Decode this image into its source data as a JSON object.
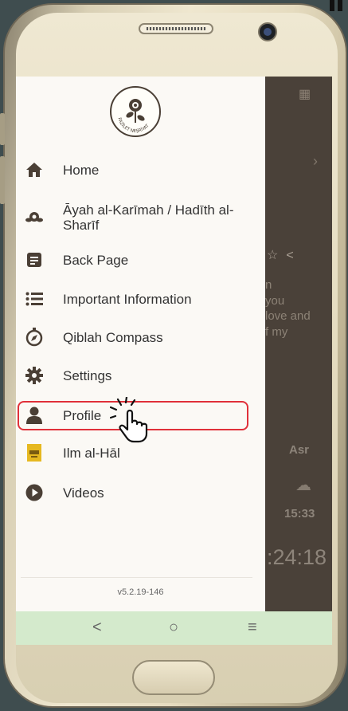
{
  "logo": {
    "text": "FAZİLET NEŞRİYAT"
  },
  "menu": [
    {
      "label": "Home",
      "icon": "home-icon"
    },
    {
      "label": "Āyah al-Karīmah / Hadīth al-Sharīf",
      "icon": "rose-icon"
    },
    {
      "label": "Back Page",
      "icon": "document-icon"
    },
    {
      "label": "Important Information",
      "icon": "list-icon"
    },
    {
      "label": "Qiblah Compass",
      "icon": "compass-icon"
    },
    {
      "label": "Settings",
      "icon": "gear-icon"
    },
    {
      "label": "Profile",
      "icon": "person-icon"
    },
    {
      "label": "Ilm al-Hāl",
      "icon": "book-icon"
    },
    {
      "label": "Videos",
      "icon": "play-icon"
    }
  ],
  "version": "v5.2.19-146",
  "background_app": {
    "text_lines": [
      "n",
      "you",
      "love and",
      "f my"
    ],
    "prayer_name": "Asr",
    "prayer_time": "15:33",
    "countdown": ":24:18"
  },
  "navbar": {
    "back": "<",
    "home": "○",
    "recents": "≡"
  },
  "colors": {
    "highlight": "#e0303a",
    "drawer_bg": "#fbf9f5",
    "navbar_bg": "#d4eacc",
    "app_bg": "#4a4139"
  }
}
